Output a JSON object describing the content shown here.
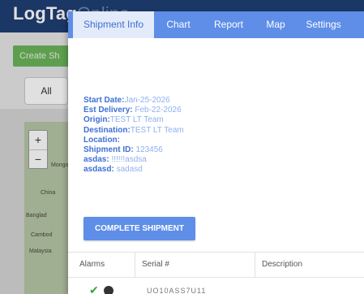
{
  "background": {
    "logo_main": "LogTag",
    "logo_sub": "Online",
    "create_button": "Create Sh",
    "filter_all": "All",
    "map": {
      "zoom_in": "+",
      "zoom_out": "−",
      "labels": [
        "Mongoli",
        "China",
        "Banglad",
        "Cambod",
        "Malaysia"
      ]
    }
  },
  "tabs": [
    {
      "label": "Shipment Info",
      "active": true
    },
    {
      "label": "Chart",
      "active": false
    },
    {
      "label": "Report",
      "active": false
    },
    {
      "label": "Map",
      "active": false
    },
    {
      "label": "Settings",
      "active": false
    }
  ],
  "shipment_info": [
    {
      "key": "Start Date:",
      "value": "Jan-25-2026"
    },
    {
      "key": "Est Delivery:",
      "value": " Feb-22-2026"
    },
    {
      "key": "Origin:",
      "value": "TEST LT Team"
    },
    {
      "key": "Destination:",
      "value": "TEST LT Team"
    },
    {
      "key": "Location:",
      "value": ""
    },
    {
      "key": "Shipment ID:",
      "value": " 123456"
    },
    {
      "key": "asdas:",
      "value": " !!!!!!asdsa"
    },
    {
      "key": "asdasd:",
      "value": " sadasd"
    }
  ],
  "complete_button": "COMPLETE SHIPMENT",
  "table": {
    "columns": [
      "Alarms",
      "Serial #",
      "Description"
    ],
    "first_row_partial": {
      "serial": "UO10ASS7U11"
    }
  },
  "colors": {
    "tab_bar": "#5f8ee8",
    "active_tab_bg": "#e3ebfb",
    "key_text": "#3e6fd4",
    "value_text": "#8fb0ef",
    "header": "#1f3f73"
  }
}
